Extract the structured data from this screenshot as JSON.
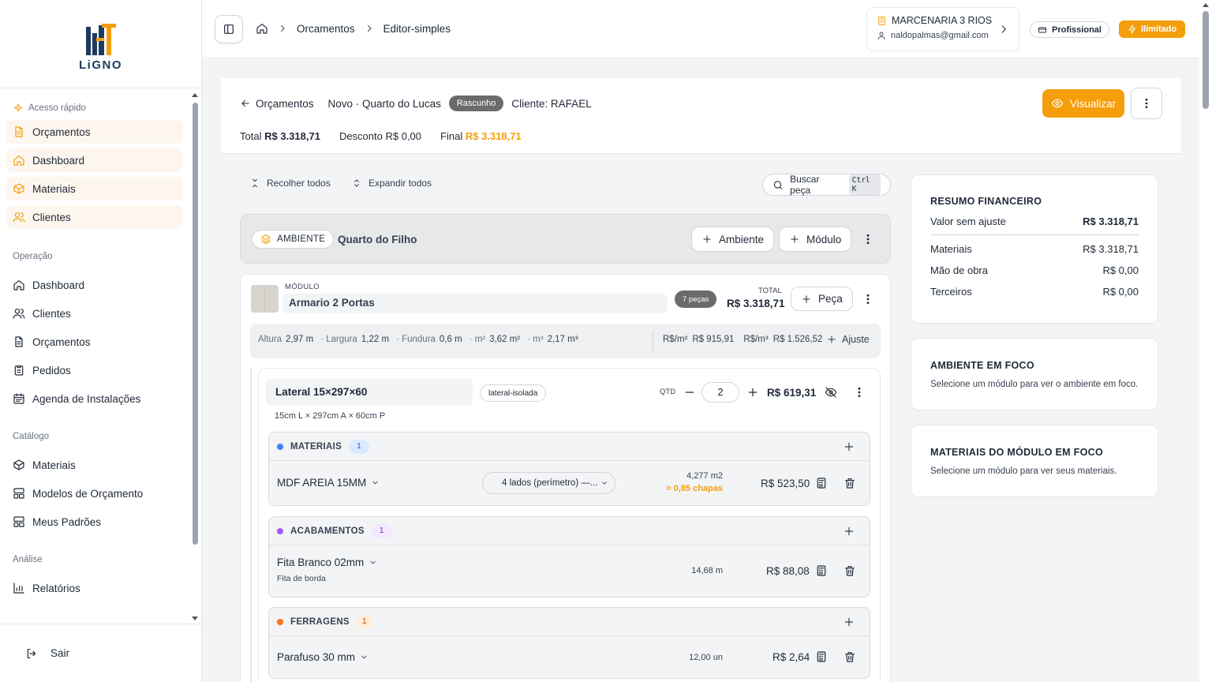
{
  "brand": {
    "name": "LiGNO",
    "colors": {
      "accent": "#f59e0b",
      "navy": "#1e3a5f"
    }
  },
  "sidebar": {
    "quick_label": "Acesso rápido",
    "quick": [
      {
        "label": "Orçamentos",
        "icon": "file-text-icon"
      },
      {
        "label": "Dashboard",
        "icon": "home-icon"
      },
      {
        "label": "Materiais",
        "icon": "box-icon"
      },
      {
        "label": "Clientes",
        "icon": "users-icon"
      }
    ],
    "sections": [
      {
        "title": "Operação",
        "items": [
          {
            "label": "Dashboard",
            "icon": "home-icon"
          },
          {
            "label": "Clientes",
            "icon": "users-icon"
          },
          {
            "label": "Orçamentos",
            "icon": "file-text-icon"
          },
          {
            "label": "Pedidos",
            "icon": "clipboard-icon"
          },
          {
            "label": "Agenda de Instalações",
            "icon": "calendar-icon"
          }
        ]
      },
      {
        "title": "Catálogo",
        "items": [
          {
            "label": "Materiais",
            "icon": "box-icon"
          },
          {
            "label": "Modelos de Orçamento",
            "icon": "layout-icon"
          },
          {
            "label": "Meus Padrões",
            "icon": "layout-icon"
          }
        ]
      },
      {
        "title": "Análise",
        "items": [
          {
            "label": "Relatórios",
            "icon": "bar-chart-icon"
          }
        ]
      }
    ],
    "logout_label": "Sair"
  },
  "topbar": {
    "breadcrumbs": [
      "Orcamentos",
      "Editor-simples"
    ],
    "company_name": "MARCENARIA 3 RIOS",
    "company_email": "naldopalmas@gmail.com",
    "plan_label": "Profissional",
    "limit_label": "Ilimitado"
  },
  "budget": {
    "back_label": "Orçamentos",
    "title": "Novo · Quarto do Lucas",
    "status": "Rascunho",
    "client": "Cliente: RAFAEL",
    "total_label": "Total",
    "total_value": "R$ 3.318,71",
    "discount_label": "Desconto",
    "discount_value": "R$ 0,00",
    "final_label": "Final",
    "final_value": "R$ 3.318,71",
    "view_label": "Visualizar"
  },
  "toolbar": {
    "collapse_all": "Recolher todos",
    "expand_all": "Expandir todos",
    "search_placeholder": "Buscar peça",
    "search_shortcut": "Ctrl K"
  },
  "ambiente": {
    "tag": "AMBIENTE",
    "name": "Quarto do Filho",
    "add_ambiente": "Ambiente",
    "add_modulo": "Módulo"
  },
  "modulo": {
    "label": "MÓDULO",
    "name": "Armario 2 Portas",
    "pieces": "7 peças",
    "total_label": "TOTAL",
    "total_value": "R$ 3.318,71",
    "add_piece": "Peça",
    "dims": {
      "altura_label": "Altura",
      "altura": "2,97 m",
      "largura_label": "· Largura",
      "largura": "1,22 m",
      "fundura_label": "· Fundura",
      "fundura": "0,6 m",
      "m2_label": "· m²",
      "m2": "3,62 m²",
      "m3_label": "· m³",
      "m3": "2,17 m³",
      "rs_m2_label": "R$/m²",
      "rs_m2": "R$ 915,91",
      "rs_m3_label": "R$/m³",
      "rs_m3": "R$ 1.526,52",
      "adjust_label": "Ajuste"
    }
  },
  "piece": {
    "name": "Lateral 15×297×60",
    "tag": "lateral-isolada",
    "dims": "15cm L × 297cm A × 60cm P",
    "qty_label": "QTD",
    "qty": "2",
    "value": "R$ 619,31"
  },
  "groups": {
    "materiais": {
      "title": "MATERIAIS",
      "count": "1",
      "color": "#3b82f6",
      "item": "MDF AREIA 15MM",
      "select": "4 lados (perímetro) —...",
      "qty": "4,277 m2",
      "chapas": "≈ 0,85 chapas",
      "value": "R$ 523,50"
    },
    "acabamentos": {
      "title": "ACABAMENTOS",
      "count": "1",
      "color": "#a855f7",
      "item": "Fita Branco 02mm",
      "sub": "Fita de borda",
      "qty": "14,68 m",
      "value": "R$ 88,08"
    },
    "ferragens": {
      "title": "FERRAGENS",
      "count": "1",
      "color": "#f97316",
      "item": "Parafuso 30 mm",
      "qty": "12,00 un",
      "value": "R$ 2,64"
    }
  },
  "summary": {
    "title": "RESUMO FINANCEIRO",
    "valor_sem_ajuste_label": "Valor sem ajuste",
    "valor_sem_ajuste": "R$ 3.318,71",
    "materiais_label": "Materiais",
    "materiais": "R$ 3.318,71",
    "mao_obra_label": "Mão de obra",
    "mao_obra": "R$ 0,00",
    "terceiros_label": "Terceiros",
    "terceiros": "R$ 0,00"
  },
  "focus_ambiente": {
    "title": "AMBIENTE EM FOCO",
    "text": "Selecione um módulo para ver o ambiente em foco."
  },
  "focus_materiais": {
    "title": "MATERIAIS DO MÓDULO EM FOCO",
    "text": "Selecione um módulo para ver seus materiais."
  }
}
